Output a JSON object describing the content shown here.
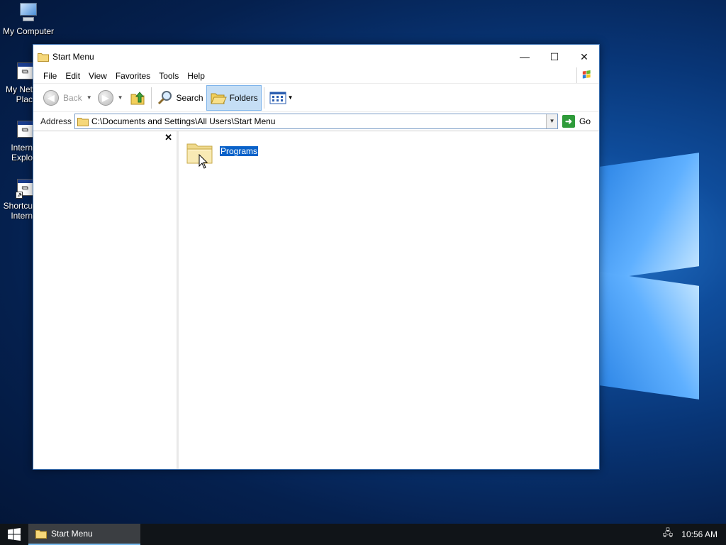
{
  "desktop": {
    "icons": [
      {
        "label": "My Computer"
      },
      {
        "label": "My Net\nPlac"
      },
      {
        "label": "Intern\nExplo"
      },
      {
        "label": "Shortcu\nIntern"
      }
    ]
  },
  "window": {
    "title": "Start Menu",
    "caption": {
      "minimize": "—",
      "maximize": "☐",
      "close": "✕"
    },
    "menu": [
      "File",
      "Edit",
      "View",
      "Favorites",
      "Tools",
      "Help"
    ],
    "toolbar": {
      "back_label": "Back",
      "search_label": "Search",
      "folders_label": "Folders"
    },
    "address": {
      "label": "Address",
      "value": "C:\\Documents and Settings\\All Users\\Start Menu",
      "go_label": "Go"
    },
    "files": [
      {
        "name": "Programs",
        "selected": true
      }
    ]
  },
  "taskbar": {
    "task_label": "Start Menu",
    "clock": "10:56 AM"
  },
  "colors": {
    "selection": "#0a62c9",
    "taskbar": "#101418",
    "accent": "#76b9ed"
  }
}
